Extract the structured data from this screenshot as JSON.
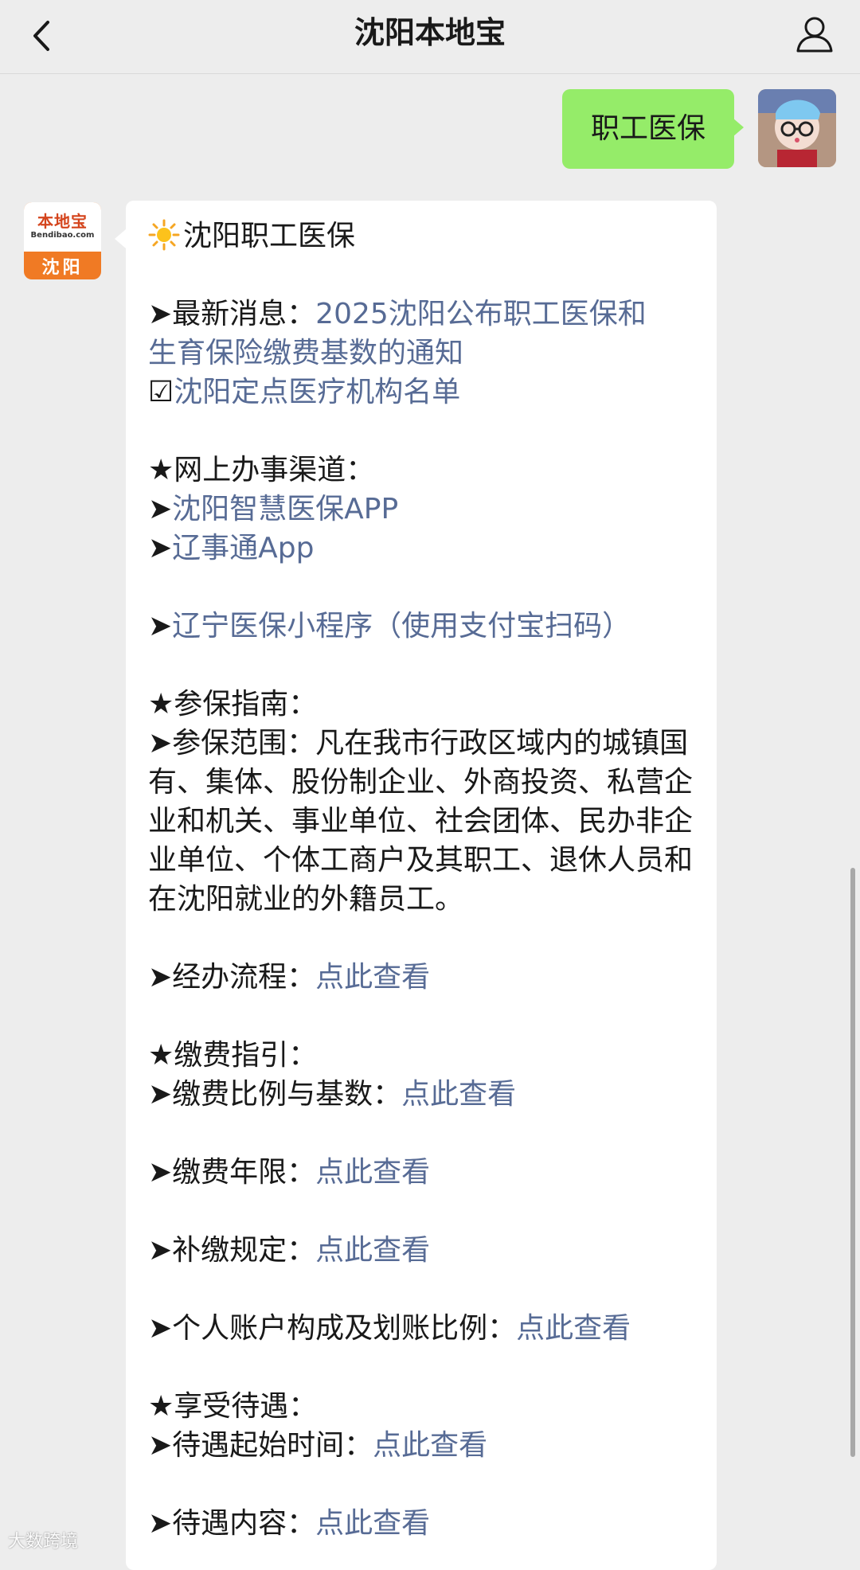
{
  "header": {
    "title": "沈阳本地宝"
  },
  "user_message": {
    "text": "职工医保"
  },
  "bot_avatar": {
    "brand": "本地宝",
    "brand_sub": "Bendibao.com",
    "city": "沈阳"
  },
  "bot_message": {
    "heading": "沈阳职工医保",
    "news_prefix": "➤最新消息：",
    "news_link_1": "2025沈阳公布职工医保和",
    "news_link_2": "生育保险缴费基数的通知",
    "checkbox_symbol": "☑",
    "hospitals_link": "沈阳定点医疗机构名单",
    "online_heading": "★网上办事渠道：",
    "arrow": "➤",
    "channel_1": "沈阳智慧医保APP",
    "channel_2": "辽事通App",
    "channel_3": "辽宁医保小程序（使用支付宝扫码）",
    "guide_heading": "★参保指南：",
    "scope_text": "➤参保范围：凡在我市行政区域内的城镇国有、集体、股份制企业、外商投资、私营企业和机关、事业单位、社会团体、民办非企业单位、个体工商户及其职工、退休人员和在沈阳就业的外籍员工。",
    "process_prefix": "➤经办流程：",
    "view_link": "点此查看",
    "payment_heading": "★缴费指引：",
    "ratio_prefix": "➤缴费比例与基数：",
    "years_prefix": "➤缴费年限：",
    "supplement_prefix": "➤补缴规定：",
    "account_prefix": "➤个人账户构成及划账比例：",
    "benefit_heading": "★享受待遇：",
    "start_prefix": "➤待遇起始时间：",
    "content_prefix": "➤待遇内容："
  },
  "watermark": "大数跨境",
  "icons": {
    "back": "chevron-left-icon",
    "profile": "user-profile-icon",
    "sun": "sun-icon"
  }
}
